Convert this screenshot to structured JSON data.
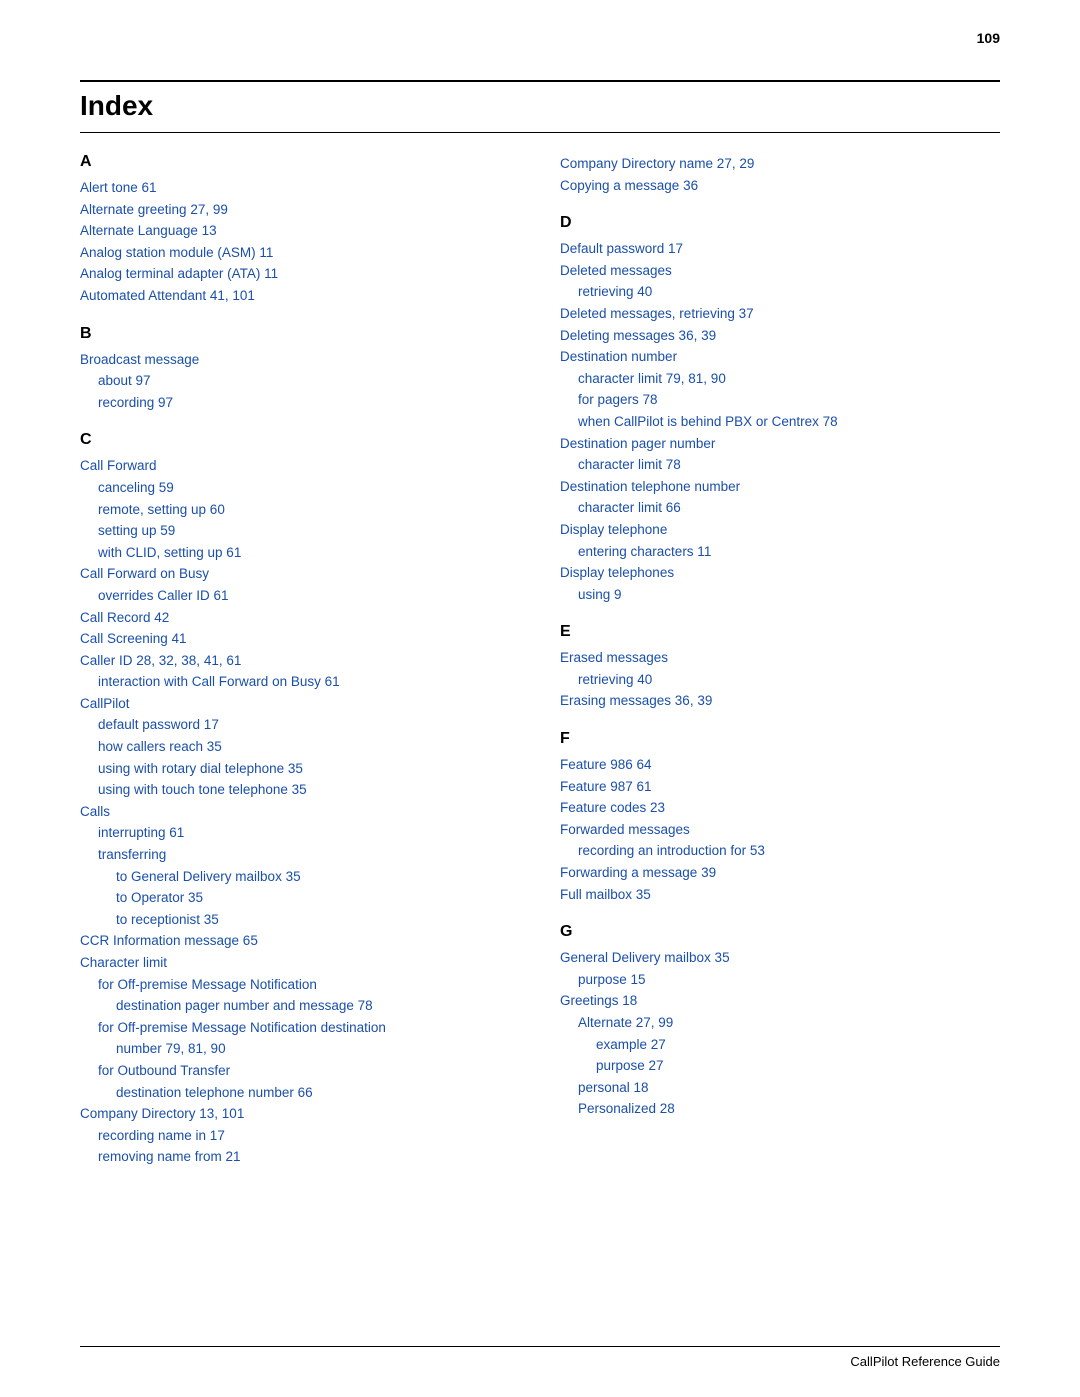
{
  "page": {
    "number": "109",
    "title": "Index",
    "footer": "CallPilot Reference Guide"
  },
  "left_column": {
    "sections": [
      {
        "letter": "A",
        "entries": [
          {
            "text": "Alert tone   61",
            "indent": 0
          },
          {
            "text": "Alternate greeting   27, 99",
            "indent": 0
          },
          {
            "text": "Alternate Language   13",
            "indent": 0
          },
          {
            "text": "Analog station module (ASM)   11",
            "indent": 0
          },
          {
            "text": "Analog terminal adapter (ATA)   11",
            "indent": 0
          },
          {
            "text": "Automated Attendant   41, 101",
            "indent": 0
          }
        ]
      },
      {
        "letter": "B",
        "entries": [
          {
            "text": "Broadcast message",
            "indent": 0
          },
          {
            "text": "about   97",
            "indent": 1
          },
          {
            "text": "recording   97",
            "indent": 1
          }
        ]
      },
      {
        "letter": "C",
        "entries": [
          {
            "text": "Call Forward",
            "indent": 0
          },
          {
            "text": "canceling   59",
            "indent": 1
          },
          {
            "text": "remote, setting up   60",
            "indent": 1
          },
          {
            "text": "setting up   59",
            "indent": 1
          },
          {
            "text": "with CLID, setting up   61",
            "indent": 1
          },
          {
            "text": "Call Forward on Busy",
            "indent": 0
          },
          {
            "text": "overrides Caller ID   61",
            "indent": 1
          },
          {
            "text": "Call Record   42",
            "indent": 0
          },
          {
            "text": "Call Screening   41",
            "indent": 0
          },
          {
            "text": "Caller ID   28, 32, 38, 41, 61",
            "indent": 0
          },
          {
            "text": "interaction with Call Forward on Busy   61",
            "indent": 1
          },
          {
            "text": "CallPilot",
            "indent": 0
          },
          {
            "text": "default password   17",
            "indent": 1
          },
          {
            "text": "how callers reach   35",
            "indent": 1
          },
          {
            "text": "using with rotary dial telephone   35",
            "indent": 1
          },
          {
            "text": "using with touch tone telephone   35",
            "indent": 1
          },
          {
            "text": "Calls",
            "indent": 0
          },
          {
            "text": "interrupting   61",
            "indent": 1
          },
          {
            "text": "transferring",
            "indent": 1
          },
          {
            "text": "to General Delivery mailbox   35",
            "indent": 2
          },
          {
            "text": "to Operator   35",
            "indent": 2
          },
          {
            "text": "to receptionist   35",
            "indent": 2
          },
          {
            "text": "CCR Information message   65",
            "indent": 0
          },
          {
            "text": "Character limit",
            "indent": 0
          },
          {
            "text": "for Off-premise Message Notification",
            "indent": 1
          },
          {
            "text": "destination pager number and message   78",
            "indent": 2
          },
          {
            "text": "for Off-premise Message Notification destination",
            "indent": 1
          },
          {
            "text": "number   79, 81, 90",
            "indent": 2
          },
          {
            "text": "for Outbound Transfer",
            "indent": 1
          },
          {
            "text": "destination telephone number   66",
            "indent": 2
          },
          {
            "text": "Company Directory   13, 101",
            "indent": 0
          },
          {
            "text": "recording name in   17",
            "indent": 1
          },
          {
            "text": "removing name from   21",
            "indent": 1
          }
        ]
      }
    ]
  },
  "right_column": {
    "sections": [
      {
        "letter": "",
        "entries": [
          {
            "text": "Company Directory name   27, 29",
            "indent": 0
          },
          {
            "text": "Copying a message   36",
            "indent": 0
          }
        ]
      },
      {
        "letter": "D",
        "entries": [
          {
            "text": "Default password   17",
            "indent": 0
          },
          {
            "text": "Deleted messages",
            "indent": 0
          },
          {
            "text": "retrieving   40",
            "indent": 1
          },
          {
            "text": "Deleted messages, retrieving   37",
            "indent": 0
          },
          {
            "text": "Deleting messages   36, 39",
            "indent": 0
          },
          {
            "text": "Destination number",
            "indent": 0
          },
          {
            "text": "character limit   79, 81, 90",
            "indent": 1
          },
          {
            "text": "for pagers   78",
            "indent": 1
          },
          {
            "text": "when CallPilot is behind PBX or Centrex   78",
            "indent": 1
          },
          {
            "text": "Destination pager number",
            "indent": 0
          },
          {
            "text": "character limit   78",
            "indent": 1
          },
          {
            "text": "Destination telephone number",
            "indent": 0
          },
          {
            "text": "character limit   66",
            "indent": 1
          },
          {
            "text": "Display telephone",
            "indent": 0
          },
          {
            "text": "entering characters   11",
            "indent": 1
          },
          {
            "text": "Display telephones",
            "indent": 0
          },
          {
            "text": "using   9",
            "indent": 1
          }
        ]
      },
      {
        "letter": "E",
        "entries": [
          {
            "text": "Erased messages",
            "indent": 0
          },
          {
            "text": "retrieving   40",
            "indent": 1
          },
          {
            "text": "Erasing messages   36, 39",
            "indent": 0
          }
        ]
      },
      {
        "letter": "F",
        "entries": [
          {
            "text": "Feature 986   64",
            "indent": 0
          },
          {
            "text": "Feature 987   61",
            "indent": 0
          },
          {
            "text": "Feature codes   23",
            "indent": 0
          },
          {
            "text": "Forwarded messages",
            "indent": 0
          },
          {
            "text": "recording an introduction for   53",
            "indent": 1
          },
          {
            "text": "Forwarding a message   39",
            "indent": 0
          },
          {
            "text": "Full mailbox   35",
            "indent": 0
          }
        ]
      },
      {
        "letter": "G",
        "entries": [
          {
            "text": "General Delivery mailbox   35",
            "indent": 0
          },
          {
            "text": "purpose   15",
            "indent": 1
          },
          {
            "text": "Greetings   18",
            "indent": 0
          },
          {
            "text": "Alternate   27, 99",
            "indent": 1
          },
          {
            "text": "example   27",
            "indent": 2
          },
          {
            "text": "purpose   27",
            "indent": 2
          },
          {
            "text": "personal   18",
            "indent": 1
          },
          {
            "text": "Personalized   28",
            "indent": 1
          }
        ]
      }
    ]
  }
}
